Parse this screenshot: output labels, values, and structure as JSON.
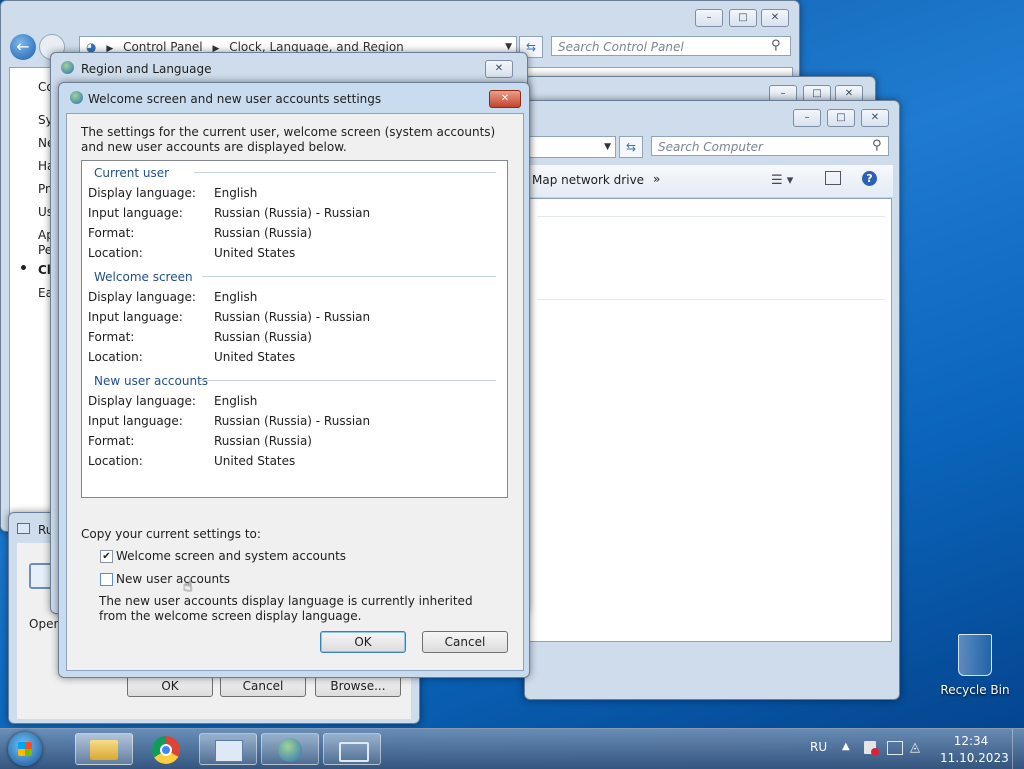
{
  "control_panel": {
    "address": [
      "Control Panel",
      "Clock, Language, and Region"
    ],
    "search_placeholder": "Search Control Panel",
    "nav_items": [
      "Co",
      "Sy",
      "Ne",
      "Ha",
      "Pro",
      "Us",
      "Ap",
      "Pe",
      "Cl",
      "Ea"
    ]
  },
  "computer_window": {
    "search_placeholder": "Search Computer",
    "toolbar": {
      "map_drive": "Map network drive",
      "more": "»"
    }
  },
  "region_dialog": {
    "title": "Region and Language"
  },
  "run_dialog": {
    "title": "Ru",
    "open_label": "Open",
    "ok": "OK",
    "cancel": "Cancel",
    "browse": "Browse..."
  },
  "welcome_dialog": {
    "title": "Welcome screen and new user accounts settings",
    "intro": "The settings for the current user, welcome screen (system accounts) and new user accounts are displayed below.",
    "groups": [
      {
        "heading": "Current user",
        "rows": [
          {
            "label": "Display language:",
            "value": "English"
          },
          {
            "label": "Input language:",
            "value": "Russian (Russia) - Russian"
          },
          {
            "label": "Format:",
            "value": "Russian (Russia)"
          },
          {
            "label": "Location:",
            "value": "United States"
          }
        ]
      },
      {
        "heading": "Welcome screen",
        "rows": [
          {
            "label": "Display language:",
            "value": "English"
          },
          {
            "label": "Input language:",
            "value": "Russian (Russia) - Russian"
          },
          {
            "label": "Format:",
            "value": "Russian (Russia)"
          },
          {
            "label": "Location:",
            "value": "United States"
          }
        ]
      },
      {
        "heading": "New user accounts",
        "rows": [
          {
            "label": "Display language:",
            "value": "English"
          },
          {
            "label": "Input language:",
            "value": "Russian (Russia) - Russian"
          },
          {
            "label": "Format:",
            "value": "Russian (Russia)"
          },
          {
            "label": "Location:",
            "value": "United States"
          }
        ]
      }
    ],
    "copy_label": "Copy your current settings to:",
    "chk_welcome": {
      "label": "Welcome screen and system accounts",
      "checked": true
    },
    "chk_new_users": {
      "label": "New user accounts",
      "checked": false
    },
    "note": "The new user accounts display language is currently inherited from the welcome screen display language.",
    "ok": "OK",
    "cancel": "Cancel"
  },
  "desktop": {
    "recycle_bin": "Recycle Bin"
  },
  "taskbar": {
    "lang": "RU",
    "time": "12:34",
    "date": "11.10.2023",
    "items": [
      "windows-explorer",
      "google-chrome",
      "control-panel",
      "region-language",
      "run"
    ]
  }
}
